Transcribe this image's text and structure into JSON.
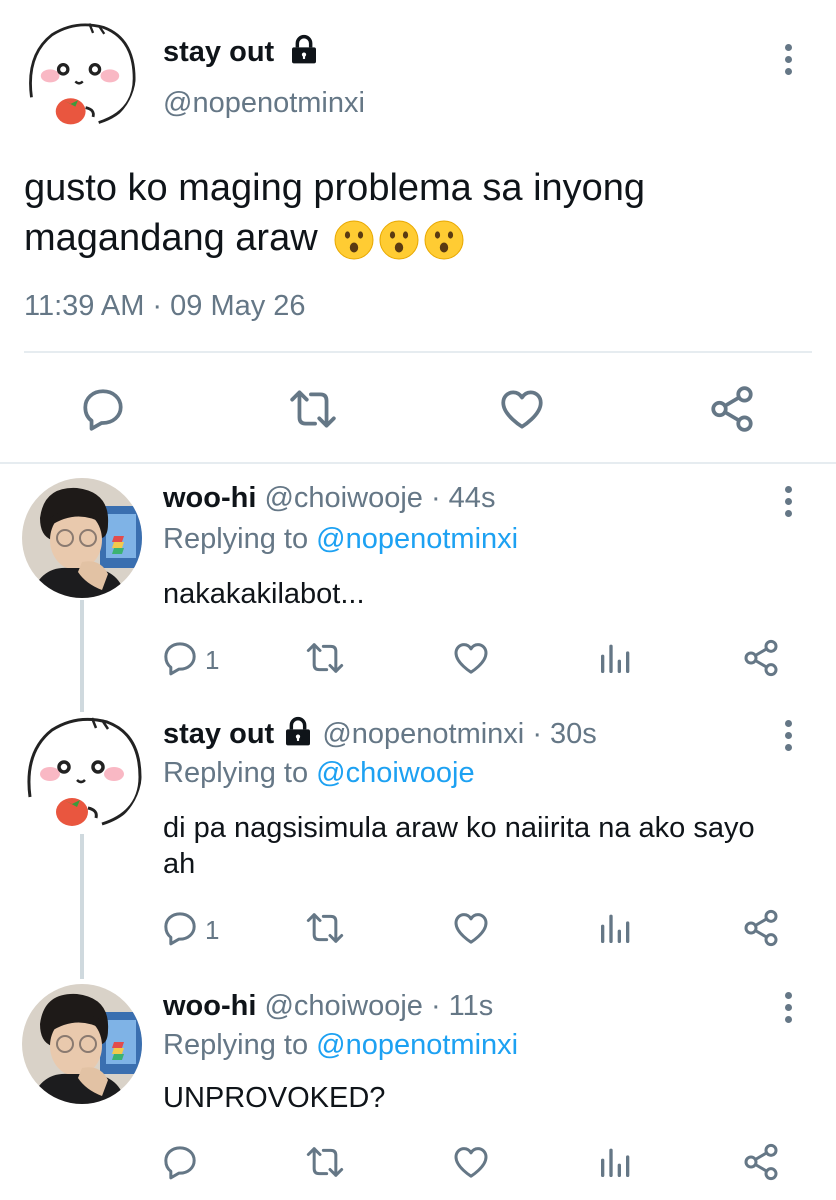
{
  "colors": {
    "text": "#0f1419",
    "secondary": "#657786",
    "link": "#1da1f2",
    "divider": "#e6ecf0"
  },
  "main_tweet": {
    "display_name": "stay out",
    "handle": "@nopenotminxi",
    "text": "gusto ko maging problema sa inyong magandang araw",
    "emojis": [
      "hushed-face",
      "hushed-face",
      "hushed-face"
    ],
    "timestamp": "11:39 AM · 09 May 26",
    "actions": [
      "reply-icon",
      "retweet-icon",
      "like-icon",
      "share-icon"
    ]
  },
  "replies": [
    {
      "display_name": "woo-hi",
      "handle": "@choiwooje",
      "age": "· 44s",
      "replying_label": "Replying to",
      "replying_handle": "@nopenotminxi",
      "text": "nakakakilabot...",
      "reply_count": "1"
    },
    {
      "display_name": "stay out",
      "handle": "@nopenotminxi",
      "age": "· 30s",
      "replying_label": "Replying to",
      "replying_handle": "@choiwooje",
      "text": "di pa nagsisimula araw ko naiirita na ako sayo ah",
      "reply_count": "1"
    },
    {
      "display_name": "woo-hi",
      "handle": "@choiwooje",
      "age": "· 11s",
      "replying_label": "Replying to",
      "replying_handle": "@nopenotminxi",
      "text": "UNPROVOKED?",
      "reply_count": ""
    }
  ]
}
